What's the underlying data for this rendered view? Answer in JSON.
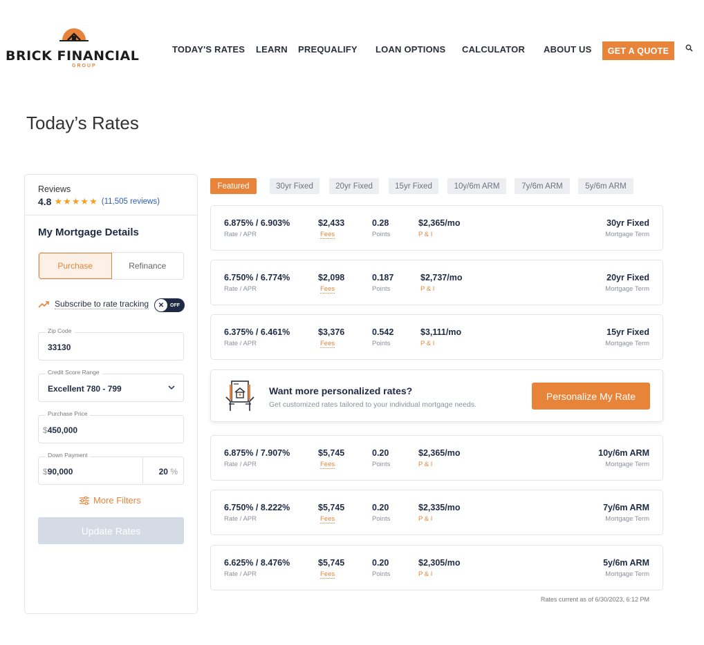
{
  "brand": {
    "name": "BRICK FINANCIAL",
    "sub": "GROUP",
    "colors": {
      "accent": "#e7843a",
      "navy": "#1f2a44",
      "link": "#2c5cc5",
      "star": "#f3a024"
    }
  },
  "nav": {
    "items": [
      "TODAY'S RATES",
      "LEARN",
      "PREQUALIFY",
      "LOAN OPTIONS",
      "CALCULATOR",
      "ABOUT US"
    ],
    "cta": "GET A QUOTE",
    "search_icon": "search-icon"
  },
  "page": {
    "title": "Today’s Rates"
  },
  "sidebar": {
    "reviews_label": "Reviews",
    "rating": "4.8",
    "stars": "★★★★★",
    "review_count": "(11,505 reviews)",
    "section_title": "My Mortgage Details",
    "loan_purpose": {
      "options": [
        "Purchase",
        "Refinance"
      ],
      "selected": "Purchase"
    },
    "rate_tracking": {
      "label": "Subscribe to rate tracking",
      "switch_text": "OFF",
      "knob": "✕"
    },
    "zip": {
      "label": "Zip Code",
      "value": "33130"
    },
    "credit": {
      "label": "Credit Score Range",
      "value": "Excellent 780 - 799"
    },
    "price": {
      "label": "Purchase Price",
      "currency": "$",
      "value": "450,000"
    },
    "down": {
      "label": "Down Payment",
      "currency": "$",
      "value": "90,000",
      "percent": "20",
      "pct_sign": "%"
    },
    "more_filters": "More Filters",
    "update_button": "Update Rates"
  },
  "tabs": [
    {
      "label": "Featured",
      "active": true
    },
    {
      "label": "30yr Fixed"
    },
    {
      "label": "20yr Fixed"
    },
    {
      "label": "15yr Fixed"
    },
    {
      "label": "10y/6m ARM"
    },
    {
      "label": "7y/6m ARM"
    },
    {
      "label": "5y/6m ARM"
    }
  ],
  "labels": {
    "rate_apr": "Rate / APR",
    "fees": "Fees",
    "points": "Points",
    "pi": "P & I",
    "term": "Mortgage Term"
  },
  "rates": [
    {
      "rate": "6.875% / 6.903%",
      "fees": "$2,433",
      "points": "0.28",
      "payment": "$2,365/mo",
      "term": "30yr Fixed"
    },
    {
      "rate": "6.750% / 6.774%",
      "fees": "$2,098",
      "points": "0.187",
      "payment": "$2,737/mo",
      "term": "20yr Fixed"
    },
    {
      "rate": "6.375% / 6.461%",
      "fees": "$3,376",
      "points": "0.542",
      "payment": "$3,111/mo",
      "term": "15yr Fixed"
    },
    {
      "rate": "6.875% / 7.907%",
      "fees": "$5,745",
      "points": "0.20",
      "payment": "$2,365/mo",
      "term": "10y/6m ARM"
    },
    {
      "rate": "6.750% / 8.222%",
      "fees": "$5,745",
      "points": "0.20",
      "payment": "$2,335/mo",
      "term": "7y/6m ARM"
    },
    {
      "rate": "6.625% / 8.476%",
      "fees": "$5,745",
      "points": "0.20",
      "payment": "$2,305/mo",
      "term": "5y/6m ARM"
    }
  ],
  "promo": {
    "title": "Want more personalized rates?",
    "subtitle": "Get customized rates tailored to your individual mortgage needs.",
    "button": "Personalize My Rate"
  },
  "footnote": "Rates current as of 6/30/2023, 6:12 PM"
}
